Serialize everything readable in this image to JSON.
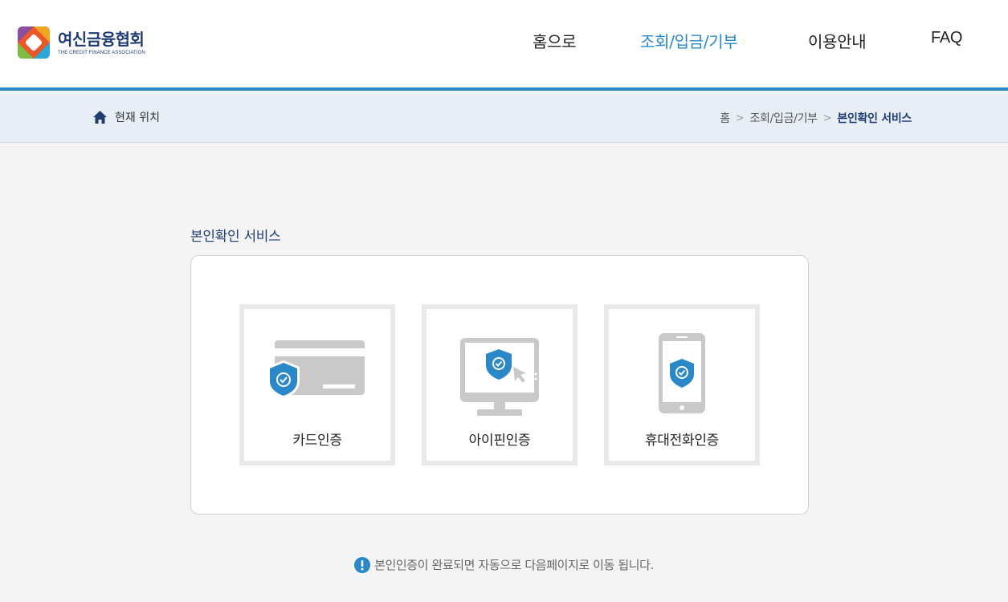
{
  "header": {
    "logo_ko": "여신금융협회",
    "logo_en": "THE CREDIT FINANCE ASSOCIATION",
    "nav": [
      {
        "label": "홈으로"
      },
      {
        "label": "조회/입금/기부"
      },
      {
        "label": "이용안내"
      },
      {
        "label": "FAQ"
      }
    ],
    "active_nav": "조회/입금/기부"
  },
  "breadcrumb": {
    "location_label": "현재 위치",
    "items": [
      "홈",
      "조회/입금/기부",
      "본인확인 서비스"
    ],
    "separator": ">"
  },
  "main": {
    "title": "본인확인 서비스",
    "options": [
      {
        "label": "카드인증",
        "icon": "credit-card-shield-icon"
      },
      {
        "label": "아이핀인증",
        "icon": "monitor-shield-icon"
      },
      {
        "label": "휴대전화인증",
        "icon": "phone-shield-icon"
      }
    ],
    "notice": "본인인증이 완료되면 자동으로 다음페이지로 이동 됩니다."
  },
  "colors": {
    "accent": "#2a88c9",
    "navy": "#1f3d73",
    "icon_gray": "#c9c9c9"
  }
}
